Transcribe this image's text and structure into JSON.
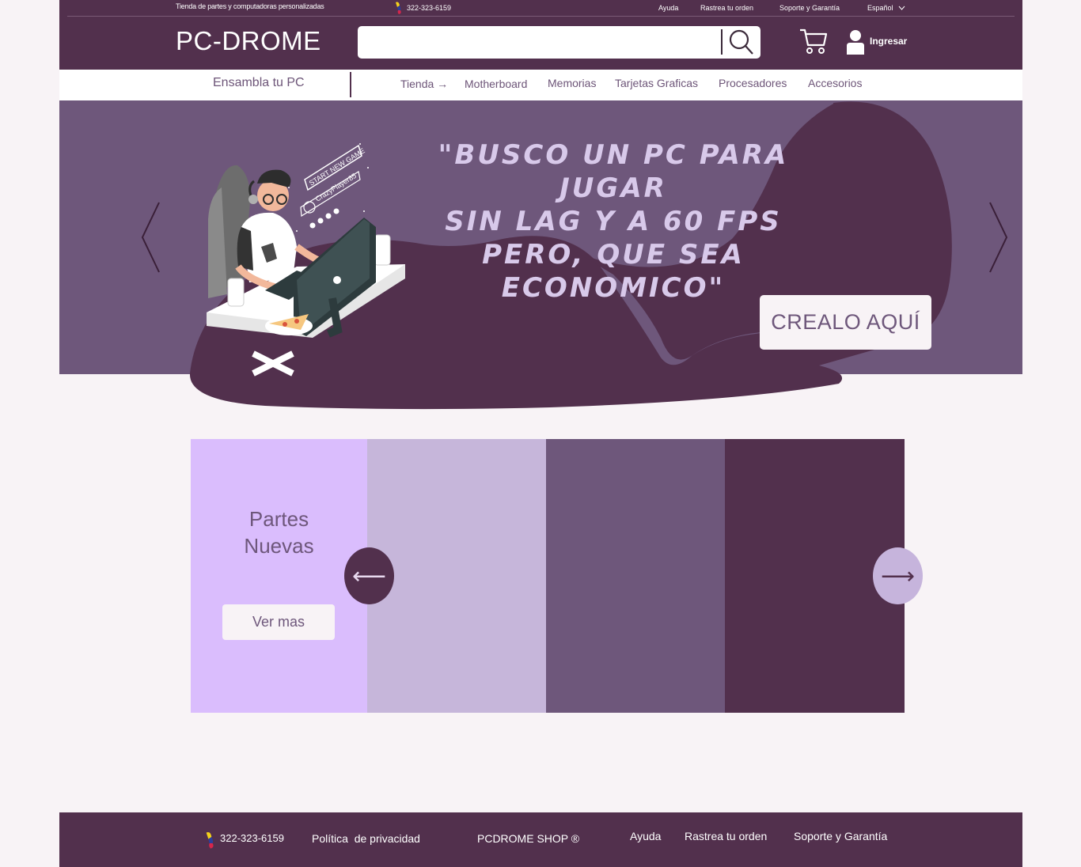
{
  "topbar": {
    "tagline": "Tienda de partes y computadoras personalizadas",
    "phone": "322-323-6159",
    "links": [
      "Ayuda",
      "Rastrea tu orden",
      "Soporte y Garantía"
    ],
    "language": "Español",
    "logo": "PC-DROME",
    "search_placeholder": "",
    "login": "Ingresar"
  },
  "nav": {
    "build": "Ensambla tu PC",
    "items": [
      "Tienda →",
      "Motherboard",
      "Memorias",
      "Tarjetas Graficas",
      "Procesadores",
      "Accesorios"
    ]
  },
  "hero": {
    "quote_lines": [
      "\"BUSCO UN PC PARA JUGAR",
      "SIN LAG Y A 60 FPS",
      "PERO, QUE SEA",
      "ECONOMICO\""
    ],
    "illustration_text": [
      "START NEW GAME",
      "CrazyPlayer85"
    ],
    "cta": "CREALO AQUÍ"
  },
  "panels": {
    "title_lines": [
      "Partes",
      "Nuevas"
    ],
    "button": "Ver mas",
    "prev": "⟵",
    "next": "⟶",
    "colors": [
      "#dabdfd",
      "#c6b6da",
      "#6e577b",
      "#52304d"
    ]
  },
  "footer": {
    "phone": "322-323-6159",
    "privacy": "Política  de privacidad",
    "shop": "PCDROME SHOP ®",
    "links": [
      "Ayuda",
      "Rastrea tu orden",
      "Soporte y Garantía"
    ]
  },
  "colors": {
    "brand_dark": "#52304d",
    "brand_mid": "#6e577b",
    "brand_light": "#dabdfd",
    "background": "#f8f3f6"
  }
}
